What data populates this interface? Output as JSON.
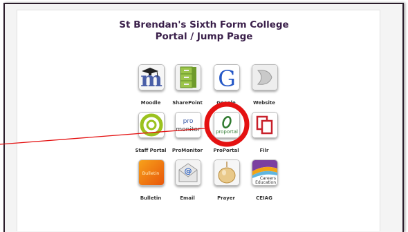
{
  "page": {
    "title_line1": "St Brendan's Sixth Form College",
    "title_line2": "Portal / Jump Page"
  },
  "tiles": {
    "moodle": {
      "label": "Moodle",
      "glyph": "m"
    },
    "sharepoint": {
      "label": "SharePoint"
    },
    "google": {
      "label": "Google",
      "glyph": "G"
    },
    "website": {
      "label": "Website"
    },
    "staff": {
      "label": "Staff Portal"
    },
    "promonitor": {
      "label": "ProMonitor",
      "logo_top": "pro",
      "logo_bottom": "monitor"
    },
    "proportal": {
      "label": "ProPortal",
      "logo_text": "proportal"
    },
    "filr": {
      "label": "Filr"
    },
    "bulletin": {
      "label": "Bulletin",
      "logo_text": "Bulletin"
    },
    "email": {
      "label": "Email",
      "glyph": "@"
    },
    "prayer": {
      "label": "Prayer"
    },
    "ceiag": {
      "label": "CEIAG",
      "logo_top": "Careers",
      "logo_bottom": "Education"
    }
  },
  "annotation": {
    "shape": "circle",
    "color": "#e41111",
    "target": "proportal"
  }
}
